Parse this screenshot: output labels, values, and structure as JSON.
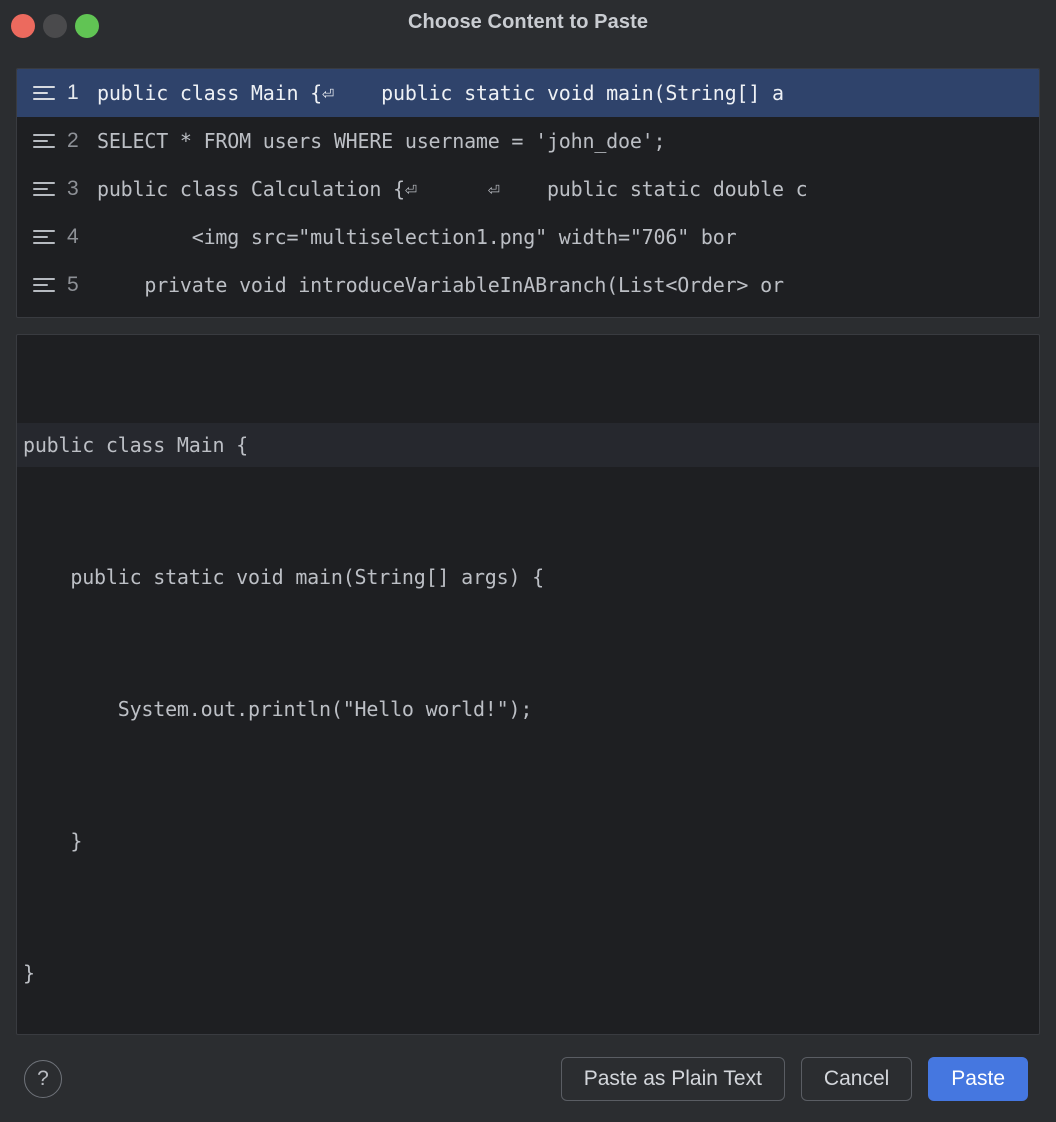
{
  "window": {
    "title": "Choose Content to Paste",
    "controls": [
      {
        "name": "close",
        "color": "#ec6a5e"
      },
      {
        "name": "minimize",
        "color": "#4a4a4c"
      },
      {
        "name": "zoom",
        "color": "#61c454"
      }
    ]
  },
  "clipboard_list": {
    "selected_index": 0,
    "icon": "list-lines-icon",
    "items": [
      {
        "number": "1",
        "text": "public class Main {⏎    public static void main(String[] a"
      },
      {
        "number": "2",
        "text": "SELECT * FROM users WHERE username = 'john_doe';"
      },
      {
        "number": "3",
        "text": "public class Calculation {⏎      ⏎    public static double c"
      },
      {
        "number": "4",
        "text": "        <img src=\"multiselection1.png\" width=\"706\" bor"
      },
      {
        "number": "5",
        "text": "    private void introduceVariableInABranch(List<Order> or"
      }
    ]
  },
  "preview": {
    "caret_line_index": 0,
    "lines": [
      "public class Main {",
      "    public static void main(String[] args) {",
      "        System.out.println(\"Hello world!\");",
      "    }",
      "}"
    ]
  },
  "footer": {
    "help_label": "?",
    "paste_plain_label": "Paste as Plain Text",
    "cancel_label": "Cancel",
    "paste_label": "Paste"
  },
  "colors": {
    "dialog_background": "#2b2d30",
    "editor_background": "#1e1f22",
    "selection_blue": "#2f436b",
    "primary_button_blue": "#4577e0",
    "caret_row": "#26282e",
    "border": "#393b40",
    "text": "#bcbfc5"
  }
}
